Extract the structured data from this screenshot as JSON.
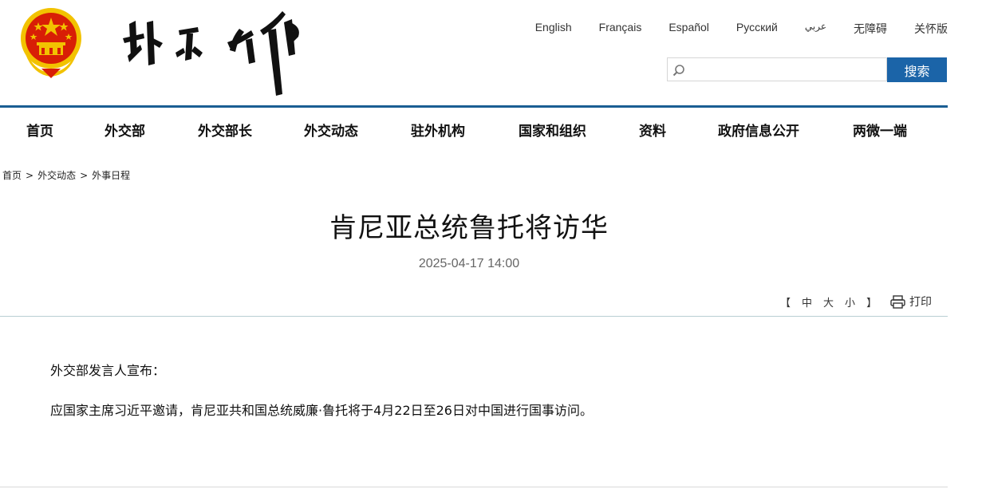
{
  "header": {
    "languages": [
      "English",
      "Français",
      "Español",
      "Русский",
      "عربي",
      "无障碍",
      "关怀版"
    ],
    "search": {
      "placeholder": "",
      "button_label": "搜索"
    },
    "colors": {
      "accent": "#1b64a8",
      "nav_line": "#1a5e93",
      "emblem_red": "#d81e06",
      "emblem_gold": "#f2c200"
    }
  },
  "nav": {
    "items": [
      "首页",
      "外交部",
      "外交部长",
      "外交动态",
      "驻外机构",
      "国家和组织",
      "资料",
      "政府信息公开",
      "两微一端"
    ]
  },
  "breadcrumb": {
    "items": [
      "首页",
      "外交动态",
      "外事日程"
    ],
    "separator": ">"
  },
  "article": {
    "title": "肯尼亚总统鲁托将访华",
    "date": "2025-04-17 14:00",
    "font_size": {
      "open": "【",
      "options": [
        "中",
        "大",
        "小"
      ],
      "close": "】"
    },
    "print_label": "打印",
    "paragraphs": [
      "外交部发言人宣布：",
      "应国家主席习近平邀请，肯尼亚共和国总统威廉·鲁托将于4月22日至26日对中国进行国事访问。"
    ]
  },
  "icons": {
    "logo": "national-emblem-icon",
    "calligraphy": "ministry-calligraphy-logo",
    "search": "search-icon",
    "print": "printer-icon"
  }
}
